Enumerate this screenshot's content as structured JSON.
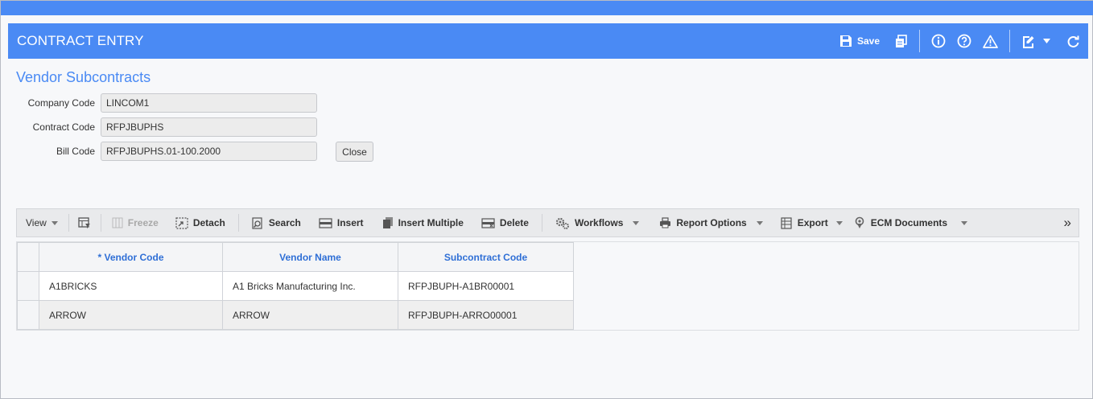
{
  "header": {
    "title": "CONTRACT ENTRY",
    "save_label": "Save",
    "accent": "#4a8af4"
  },
  "section": {
    "title": "Vendor Subcontracts"
  },
  "form": {
    "company_code": {
      "label": "Company Code",
      "value": "LINCOM1"
    },
    "contract_code": {
      "label": "Contract Code",
      "value": "RFPJBUPHS"
    },
    "bill_code": {
      "label": "Bill Code",
      "value": "RFPJBUPHS.01-100.2000"
    },
    "close_label": "Close"
  },
  "toolbar": {
    "view": "View",
    "freeze": "Freeze",
    "detach": "Detach",
    "search": "Search",
    "insert": "Insert",
    "insert_multiple": "Insert Multiple",
    "delete": "Delete",
    "workflows": "Workflows",
    "report_options": "Report Options",
    "export": "Export",
    "ecm_documents": "ECM Documents",
    "more": "»"
  },
  "grid": {
    "columns": [
      "* Vendor Code",
      "Vendor Name",
      "Subcontract Code"
    ],
    "rows": [
      [
        "A1BRICKS",
        "A1 Bricks Manufacturing Inc.",
        "RFPJBUPH-A1BR00001"
      ],
      [
        "ARROW",
        "ARROW",
        "RFPJBUPH-ARRO00001"
      ]
    ]
  }
}
